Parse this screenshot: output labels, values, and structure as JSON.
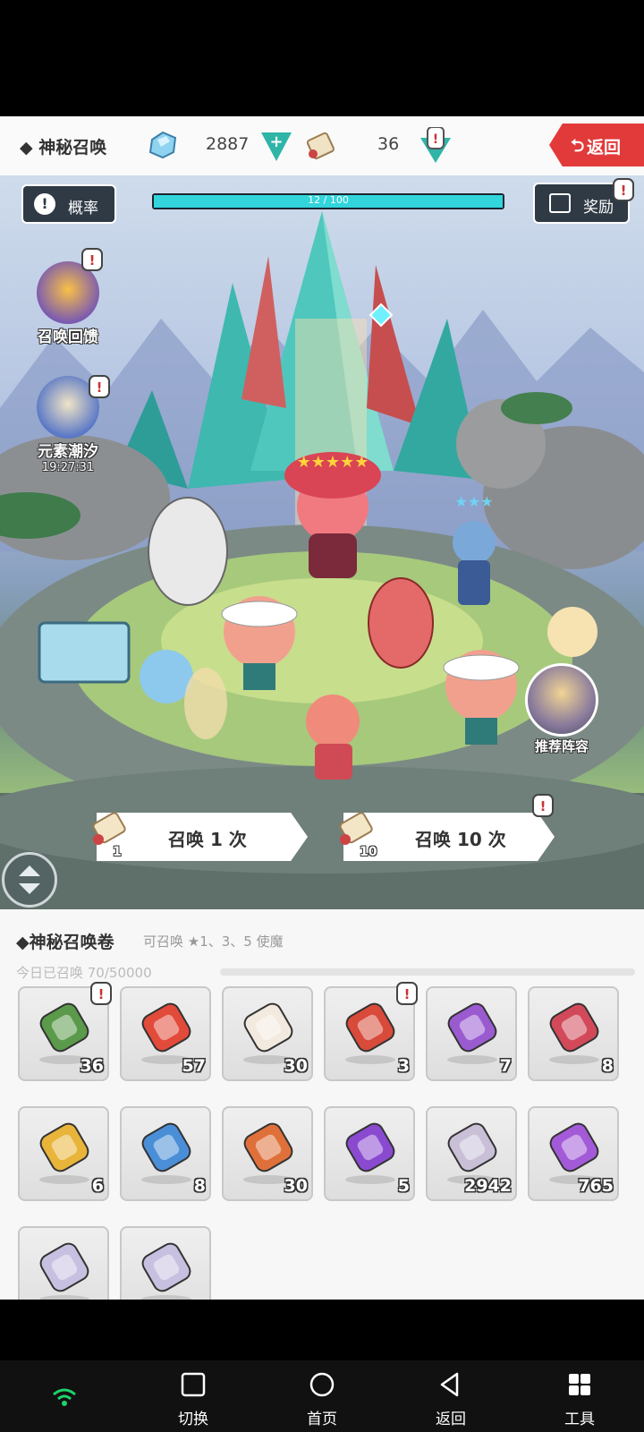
{
  "header": {
    "title": "◆ 神秘召唤",
    "crystal_count": "2887",
    "scroll_count": "36",
    "back_label": "返回",
    "back_icon": "return-arrow-icon"
  },
  "scene": {
    "probability_label": "概率",
    "progress_label": "12 / 100",
    "progress_fraction": 0.12,
    "reward_label": "奖励",
    "events": [
      {
        "label": "召唤回馈",
        "icon": "summon-feedback-icon"
      },
      {
        "label": "元素潮汐",
        "time": "19:27:31",
        "icon": "element-tide-icon"
      }
    ],
    "recommend_label": "推荐阵容",
    "summon_once": {
      "label": "召唤 1 次",
      "cost": "1"
    },
    "summon_ten": {
      "label": "召唤 10 次",
      "cost": "10"
    }
  },
  "panel": {
    "title": "◆神秘召唤卷",
    "subtitle": "可召唤 ★1、3、5 使魔",
    "today": "今日已召唤 70/50000",
    "items": [
      {
        "count": "36",
        "icon": "scroll-check-icon"
      },
      {
        "count": "57",
        "icon": "heart-icon"
      },
      {
        "count": "30",
        "icon": "white-scroll-icon"
      },
      {
        "count": "3",
        "icon": "red-scroll-ball-icon"
      },
      {
        "count": "7",
        "icon": "purple-scroll-icon"
      },
      {
        "count": "8",
        "icon": "red-scroll-icon"
      },
      {
        "count": "6",
        "icon": "yellow-scroll-icon"
      },
      {
        "count": "8",
        "icon": "blue-scroll-icon"
      },
      {
        "count": "30",
        "icon": "orange-scroll-ball-icon"
      },
      {
        "count": "5",
        "icon": "purple-scroll-ball-icon"
      },
      {
        "count": "2942",
        "icon": "silver-shard-icon"
      },
      {
        "count": "765",
        "icon": "purple-shard-icon"
      },
      {
        "count": "",
        "icon": "three-star-soul-icon"
      },
      {
        "count": "",
        "icon": "five-star-soul-icon"
      }
    ]
  },
  "nav": {
    "switch": "切换",
    "home": "首页",
    "back": "返回",
    "tools": "工具"
  },
  "colors": {
    "accent_teal": "#32d5dc",
    "back_red": "#e23a3a",
    "dark_button": "#2f3a45"
  }
}
